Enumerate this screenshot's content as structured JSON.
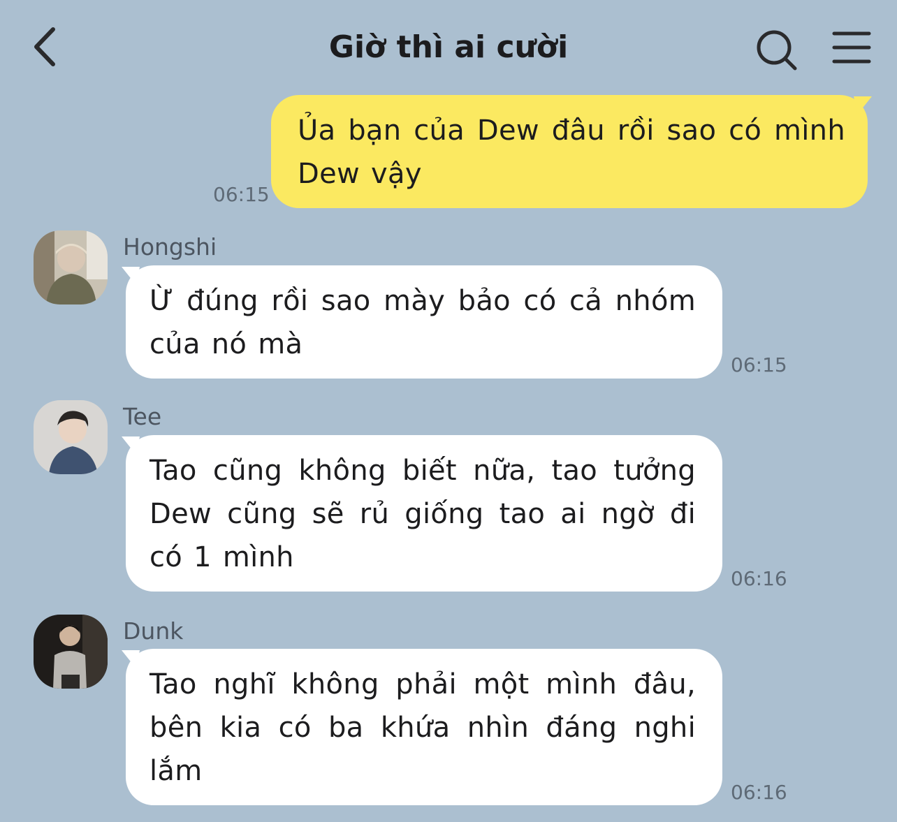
{
  "header": {
    "title": "Giờ thì ai cười",
    "back_icon": "chevron-left-icon",
    "search_icon": "search-icon",
    "menu_icon": "hamburger-menu-icon"
  },
  "colors": {
    "background": "#abbfd0",
    "outgoing_bubble": "#fbe961",
    "incoming_bubble": "#ffffff",
    "text": "#1c1c1e",
    "timestamp": "#5e6a76"
  },
  "messages": [
    {
      "direction": "outgoing",
      "text": "Ủa bạn của Dew đâu rồi sao có mình Dew vậy",
      "time": "06:15"
    },
    {
      "direction": "incoming",
      "sender": "Hongshi",
      "text": "Ừ đúng rồi sao mày bảo có cả nhóm của nó mà",
      "time": "06:15"
    },
    {
      "direction": "incoming",
      "sender": "Tee",
      "text": "Tao cũng không biết nữa, tao tưởng Dew cũng sẽ rủ giống tao ai ngờ đi có 1 mình",
      "time": "06:16"
    },
    {
      "direction": "incoming",
      "sender": "Dunk",
      "text": "Tao nghĩ không phải một mình đâu, bên kia có ba khứa nhìn đáng nghi lắm",
      "time": "06:16"
    }
  ]
}
